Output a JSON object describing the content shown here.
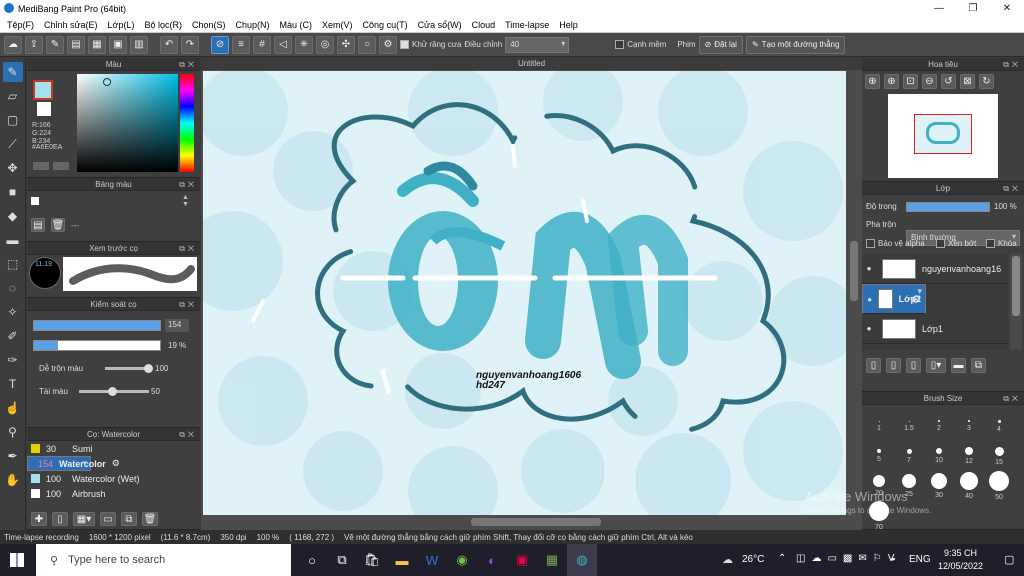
{
  "window": {
    "title": "MediBang Paint Pro (64bit)",
    "min": "—",
    "max": "❐",
    "close": "✕"
  },
  "menu": [
    "Tệp(F)",
    "Chỉnh sửa(E)",
    "Lớp(L)",
    "Bộ lọc(R)",
    "Chọn(S)",
    "Chụp(N)",
    "Màu (C)",
    "Xem(V)",
    "Công cụ(T)",
    "Cửa sổ(W)",
    "Cloud",
    "Time-lapse",
    "Help"
  ],
  "toolbar": {
    "antialias_label": "Khử răng cưa",
    "adjust_label": "Điều chỉnh",
    "adjust_value": "40",
    "edge_label": "Cạnh mềm",
    "phim_label": "Phim",
    "reset_label": "Đặt lại",
    "straight_label": "Tạo một đường thẳng"
  },
  "color_panel": {
    "title": "Màu",
    "r": "R:166",
    "g": "G:224",
    "b": "B:234",
    "hex": "#A6E0EA"
  },
  "palette_panel": {
    "title": "Bảng màu",
    "empty": "---"
  },
  "brush_preview": {
    "title": "Xem trước cọ",
    "size": "11.19"
  },
  "brush_control": {
    "title": "Kiểm soát cọ",
    "size_value": "154",
    "opacity_value": "19 %",
    "mix_label": "Dễ trộn màu",
    "mix_value": "100",
    "load_label": "Tài màu",
    "load_value": "50"
  },
  "brush_list": {
    "title": "Cọ: Watercolor",
    "items": [
      {
        "size": "30",
        "name": "Sumi",
        "color": "#e8d000"
      },
      {
        "size": "154",
        "name": "Watercolor",
        "color": "#a6e0ea"
      },
      {
        "size": "100",
        "name": "Watercolor (Wet)",
        "color": "#a6e0ea"
      },
      {
        "size": "100",
        "name": "Airbrush",
        "color": "#ffffff"
      }
    ]
  },
  "canvas": {
    "doc_title": "Untitled",
    "signature_line1": "nguyenvanhoang1606",
    "signature_line2": "hd247"
  },
  "navigator": {
    "title": "Hoa tiêu"
  },
  "layers": {
    "title": "Lớp",
    "opacity_label": "Độ trong",
    "opacity_value": "100 %",
    "blend_label": "Pha trộn",
    "blend_value": "Bình thường",
    "protect_alpha": "Bảo vệ alpha",
    "clip": "Xén bớt",
    "lock": "Khóa",
    "items": [
      {
        "name": "nguyenvanhoang16",
        "selected": false
      },
      {
        "name": "Lớp2",
        "selected": true
      },
      {
        "name": "Lớp1",
        "selected": false
      }
    ]
  },
  "brush_size": {
    "title": "Brush Size",
    "sizes": [
      "1",
      "1.5",
      "2",
      "3",
      "4",
      "5",
      "7",
      "10",
      "12",
      "15",
      "20",
      "25",
      "30",
      "40",
      "50",
      "70"
    ]
  },
  "watermark": {
    "line1": "Activate Windows",
    "line2": "Go to Settings to activate Windows."
  },
  "status": {
    "recording": "Time-lapse recording",
    "size": "1600 * 1200 pixel",
    "cm": "(11.6 * 8.7cm)",
    "dpi": "350 dpi",
    "zoom": "100 %",
    "coords": "( 1168, 272 )",
    "hint": "Vẽ một đường thẳng bằng cách giữ phím Shift, Thay đổi cỡ cọ bằng cách giữ phím Ctrl, Alt và kéo"
  },
  "taskbar": {
    "search_placeholder": "Type here to search",
    "weather": "26°C",
    "lang": "ENG",
    "time": "9:35 CH",
    "date": "12/05/2022"
  },
  "colors": {
    "accent": "#2d6fb3",
    "fg": "#c0392b",
    "canvas_bg": "#dff2f7",
    "ink": "#3fb0c6"
  }
}
